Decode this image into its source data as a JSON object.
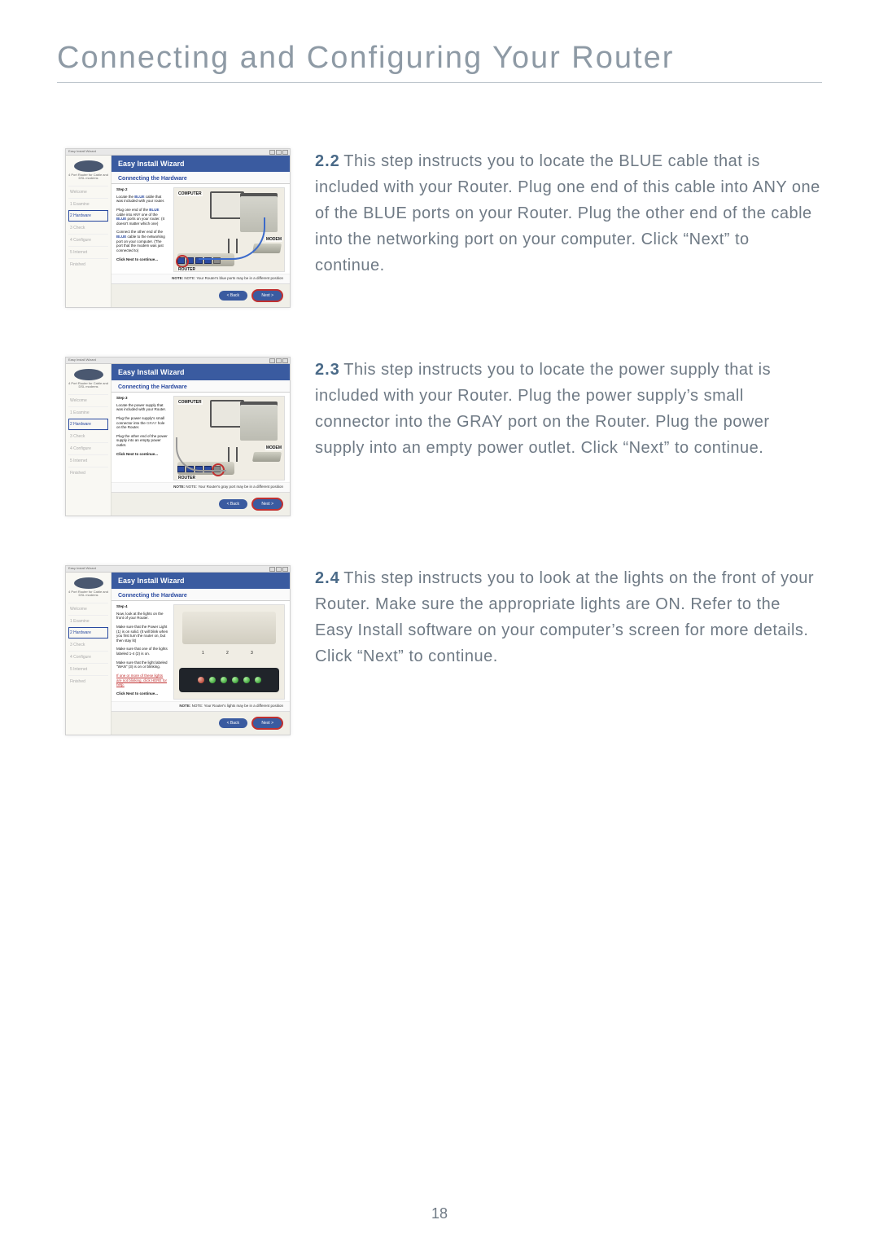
{
  "page_title": "Connecting and Configuring Your Router",
  "page_number": "18",
  "wizard": {
    "titlebar": "Easy Install Wizard",
    "header": "Easy Install Wizard",
    "subheader": "Connecting the Hardware",
    "brand": "BELKIN",
    "brand_sub": "4 Port Router for Cable and DSL modems",
    "side_items": [
      "Welcome",
      "1 Examine",
      "2 Hardware",
      "3 Check",
      "4 Configure",
      "5 Internet",
      "Finished"
    ],
    "back": "< Back",
    "next": "Next >"
  },
  "screens": [
    {
      "step_head": "Step 2",
      "lines": [
        "Locate the <span class='hl-blue'>BLUE</span> cable that was included with your router.",
        "Plug one end of the <span class='hl-blue'>BLUE</span> cable into ANY one of the <span class='hl-blue'>BLUE</span> ports on your router. (It doesn't matter which one)",
        "Connect the other end of the <span class='hl-blue'>BLUE</span> cable to the networking port on your computer. (The port that the modem was just connected to)",
        "Click Next to continue..."
      ],
      "note": "NOTE: Your Router's blue ports may be in a different position",
      "labels": {
        "computer": "COMPUTER",
        "modem": "MODEM",
        "router": "ROUTER"
      }
    },
    {
      "step_head": "Step 3",
      "lines": [
        "Locate the power supply that was included with your Router.",
        "Plug the power supply's small connector into the <span class='hl-gray'>GRAY</span> hole on the Router.",
        "Plug the other end of the power supply into an empty power outlet.",
        "Click Next to continue..."
      ],
      "note": "NOTE: Your Router's gray port may be in a different position",
      "labels": {
        "computer": "COMPUTER",
        "modem": "MODEM",
        "router": "ROUTER"
      }
    },
    {
      "step_head": "Step 4",
      "lines": [
        "Now, look at the lights on the front of your Router.",
        "Make sure that the Power Light (1) is on solid. (It will blink when you first turn the router on, but then stay lit)",
        "Make sure that one of the lights labeled 1-4 (2) is on.",
        "Make sure that the light labeled \"WAN\" (3) is on or blinking.",
        "<span class='hl-red'>If one or more of these lights are not blinking, click HERE for help.</span>",
        "Click Next to continue..."
      ],
      "note": "NOTE: Your Router's lights may be in a different position",
      "numbers": [
        "1",
        "2",
        "3"
      ]
    }
  ],
  "steps": [
    {
      "num": "2.2",
      "text": "This step instructs you to locate the BLUE cable that is included with your Router. Plug one end of this cable into ANY one of the BLUE ports on your Router. Plug the other end of the cable into the networking port on your computer. Click “Next” to continue."
    },
    {
      "num": "2.3",
      "text": "This step instructs you to locate the power supply that is included with your Router. Plug the power supply’s small connector into the GRAY port on the Router. Plug the power supply into an empty power outlet. Click “Next” to continue."
    },
    {
      "num": "2.4",
      "text": "This step instructs you to look at the lights on the front of your Router. Make sure the appropriate lights are ON. Refer to the Easy Install software on your computer’s screen for more details. Click “Next” to continue."
    }
  ]
}
